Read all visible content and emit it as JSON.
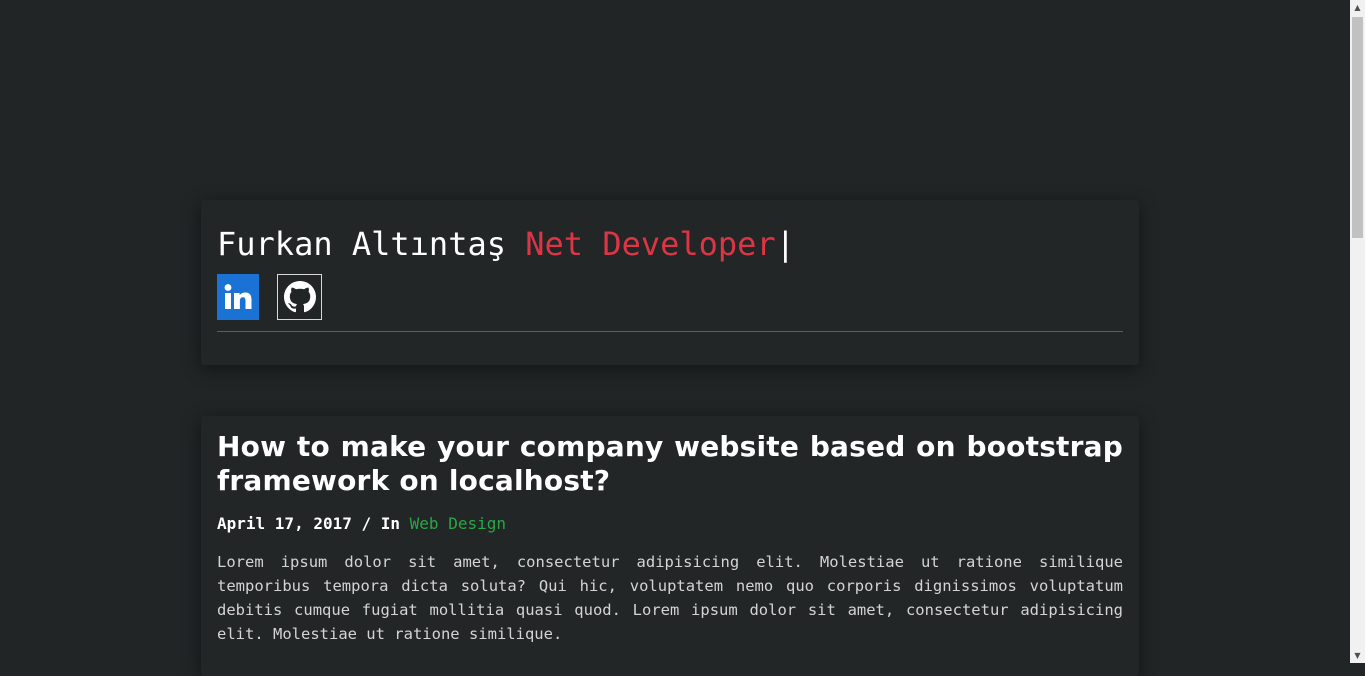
{
  "header": {
    "name": "Furkan Altıntaş",
    "role": "Net Developer",
    "cursor": "|",
    "social": {
      "linkedin_icon": "linkedin-icon",
      "github_icon": "github-icon",
      "linkedin_color": "#1a73d4"
    }
  },
  "post": {
    "title": "How to make your company website based on bootstrap framework on localhost?",
    "date": "April 17, 2017",
    "separator": " / In ",
    "category": "Web Design",
    "excerpt": "Lorem ipsum dolor sit amet, consectetur adipisicing elit. Molestiae ut ratione similique temporibus tempora dicta soluta? Qui hic, voluptatem nemo quo corporis dignissimos voluptatum debitis cumque fugiat mollitia quasi quod. Lorem ipsum dolor sit amet, consectetur adipisicing elit. Molestiae ut ratione similique."
  },
  "colors": {
    "background": "#212526",
    "accent": "#dc3545",
    "category": "#28a745"
  },
  "scrollbar": {
    "up_arrow": "▲",
    "down_arrow": "▼"
  }
}
